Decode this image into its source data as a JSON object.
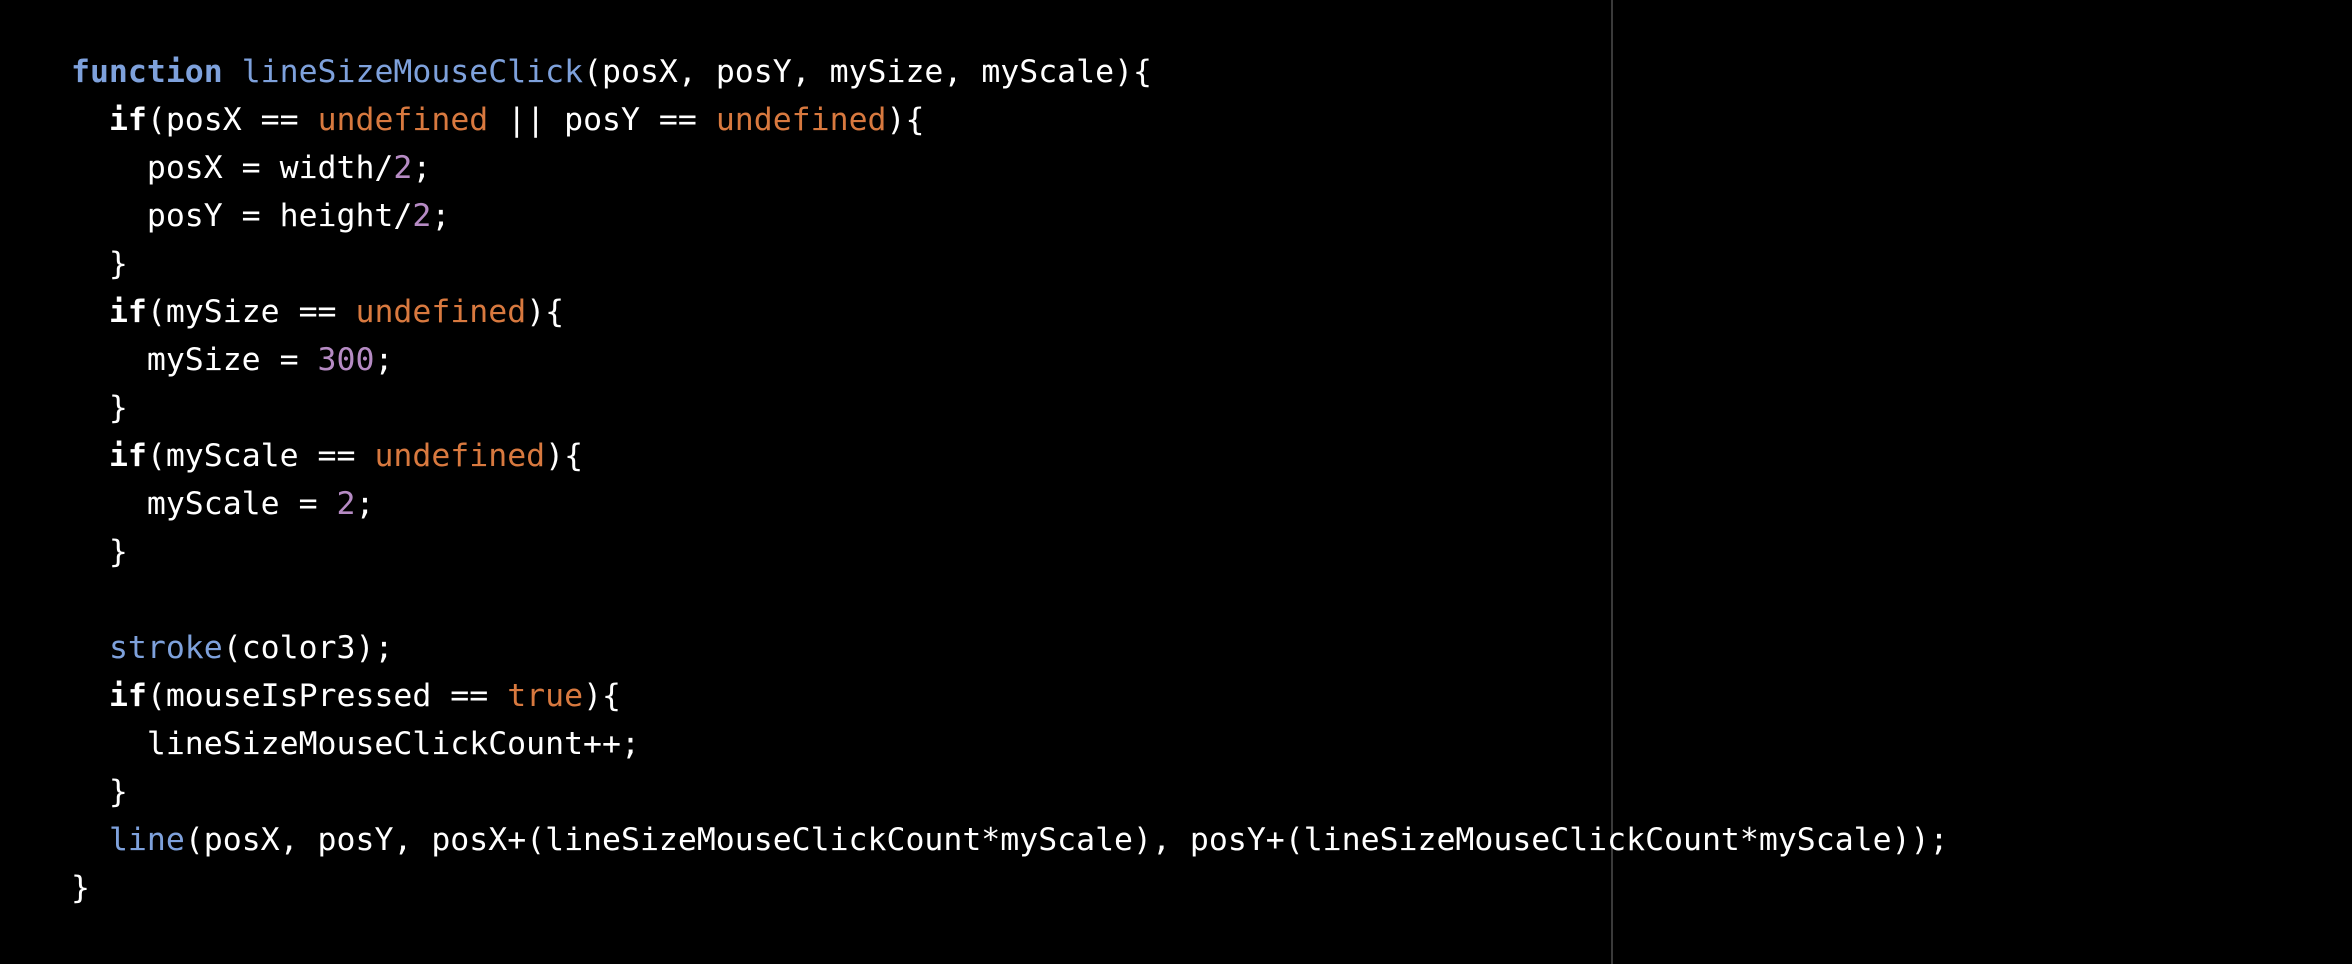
{
  "editor": {
    "background": "#000000",
    "colors": {
      "keyword": "#7ea1dc",
      "function_name": "#7ea1dc",
      "builtin": "#7ea1dc",
      "literal": "#d8793f",
      "number": "#b68bc4",
      "text": "#ffffff",
      "print_margin": "#3a3a3a"
    },
    "lines": [
      [
        {
          "t": "function",
          "k": "keyword"
        },
        {
          "t": " ",
          "k": "plain"
        },
        {
          "t": "lineSizeMouseClick",
          "k": "fn-name"
        },
        {
          "t": "(posX, posY, mySize, myScale){",
          "k": "plain"
        }
      ],
      [
        {
          "t": "  ",
          "k": "plain"
        },
        {
          "t": "if",
          "k": "control"
        },
        {
          "t": "(posX == ",
          "k": "plain"
        },
        {
          "t": "undefined",
          "k": "literal"
        },
        {
          "t": " || posY == ",
          "k": "plain"
        },
        {
          "t": "undefined",
          "k": "literal"
        },
        {
          "t": "){",
          "k": "plain"
        }
      ],
      [
        {
          "t": "    posX = width/",
          "k": "plain"
        },
        {
          "t": "2",
          "k": "number"
        },
        {
          "t": ";",
          "k": "plain"
        }
      ],
      [
        {
          "t": "    posY = height/",
          "k": "plain"
        },
        {
          "t": "2",
          "k": "number"
        },
        {
          "t": ";",
          "k": "plain"
        }
      ],
      [
        {
          "t": "  }",
          "k": "plain"
        }
      ],
      [
        {
          "t": "  ",
          "k": "plain"
        },
        {
          "t": "if",
          "k": "control"
        },
        {
          "t": "(mySize == ",
          "k": "plain"
        },
        {
          "t": "undefined",
          "k": "literal"
        },
        {
          "t": "){",
          "k": "plain"
        }
      ],
      [
        {
          "t": "    mySize = ",
          "k": "plain"
        },
        {
          "t": "300",
          "k": "number"
        },
        {
          "t": ";",
          "k": "plain"
        }
      ],
      [
        {
          "t": "  }",
          "k": "plain"
        }
      ],
      [
        {
          "t": "  ",
          "k": "plain"
        },
        {
          "t": "if",
          "k": "control"
        },
        {
          "t": "(myScale == ",
          "k": "plain"
        },
        {
          "t": "undefined",
          "k": "literal"
        },
        {
          "t": "){",
          "k": "plain"
        }
      ],
      [
        {
          "t": "    myScale = ",
          "k": "plain"
        },
        {
          "t": "2",
          "k": "number"
        },
        {
          "t": ";",
          "k": "plain"
        }
      ],
      [
        {
          "t": "  }",
          "k": "plain"
        }
      ],
      [],
      [
        {
          "t": "  ",
          "k": "plain"
        },
        {
          "t": "stroke",
          "k": "builtin"
        },
        {
          "t": "(color3);",
          "k": "plain"
        }
      ],
      [
        {
          "t": "  ",
          "k": "plain"
        },
        {
          "t": "if",
          "k": "control"
        },
        {
          "t": "(mouseIsPressed == ",
          "k": "plain"
        },
        {
          "t": "true",
          "k": "literal"
        },
        {
          "t": "){",
          "k": "plain"
        }
      ],
      [
        {
          "t": "    lineSizeMouseClickCount++;",
          "k": "plain"
        }
      ],
      [
        {
          "t": "  }",
          "k": "plain"
        }
      ],
      [
        {
          "t": "  ",
          "k": "plain"
        },
        {
          "t": "line",
          "k": "builtin"
        },
        {
          "t": "(posX, posY, posX+(lineSizeMouseClickCount*myScale), posY+(lineSizeMouseClickCount*myScale));",
          "k": "plain"
        }
      ],
      [
        {
          "t": "}",
          "k": "plain"
        }
      ]
    ]
  }
}
